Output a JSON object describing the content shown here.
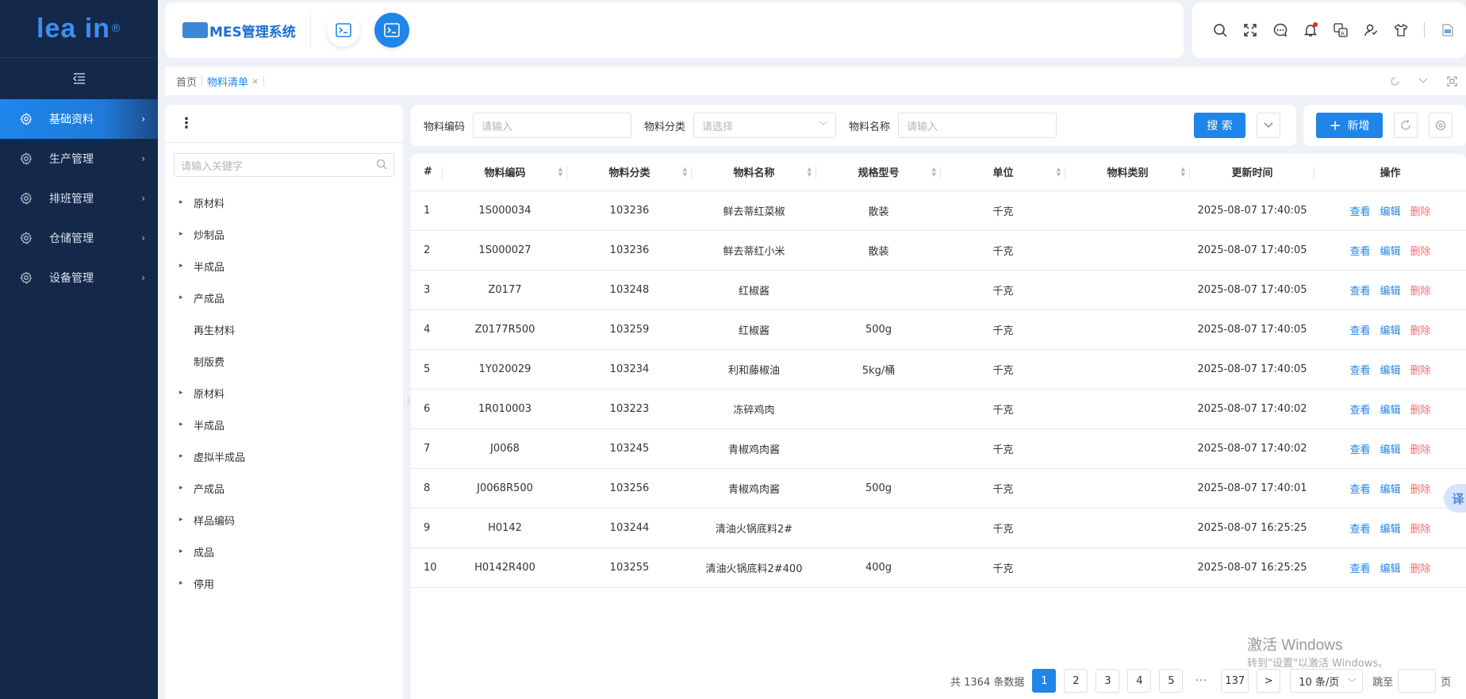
{
  "app": {
    "logo_text": "lea  in",
    "logo_mark": "®",
    "brand_text": "MES管理系统"
  },
  "sidebar": {
    "collapse_icon": "menu-fold-icon",
    "items": [
      {
        "label": "基础资料",
        "icon": "gear-icon",
        "active": true
      },
      {
        "label": "生产管理",
        "icon": "gear-icon",
        "active": false
      },
      {
        "label": "排班管理",
        "icon": "gear-icon",
        "active": false
      },
      {
        "label": "仓储管理",
        "icon": "gear-icon",
        "active": false
      },
      {
        "label": "设备管理",
        "icon": "gear-icon",
        "active": false
      }
    ]
  },
  "header": {
    "icons": [
      "search-icon",
      "fullscreen-icon",
      "message-icon",
      "bell-icon",
      "translate-icon",
      "user-icon",
      "theme-shirt-icon",
      "avatar-image"
    ]
  },
  "tabs": [
    {
      "label": "首页",
      "active": false
    },
    {
      "label": "物料清单",
      "active": true,
      "close": "×"
    }
  ],
  "tree": {
    "search_placeholder": "请输入关键字",
    "nodes": [
      {
        "label": "原材料",
        "expandable": true
      },
      {
        "label": "炒制品",
        "expandable": true
      },
      {
        "label": "半成品",
        "expandable": true
      },
      {
        "label": "产成品",
        "expandable": true
      },
      {
        "label": "再生材料",
        "expandable": false
      },
      {
        "label": "制版费",
        "expandable": false
      },
      {
        "label": "原材料",
        "expandable": true
      },
      {
        "label": "半成品",
        "expandable": true
      },
      {
        "label": "虚拟半成品",
        "expandable": true
      },
      {
        "label": "产成品",
        "expandable": true
      },
      {
        "label": "样品编码",
        "expandable": true
      },
      {
        "label": "成品",
        "expandable": true
      },
      {
        "label": "停用",
        "expandable": true
      }
    ]
  },
  "search": {
    "code_label": "物料编码",
    "code_placeholder": "请输入",
    "category_label": "物料分类",
    "category_placeholder": "请选择",
    "name_label": "物料名称",
    "name_placeholder": "请输入",
    "search_button": "搜 索",
    "add_button": "新增"
  },
  "table": {
    "columns": [
      "#",
      "物料编码",
      "物料分类",
      "物料名称",
      "规格型号",
      "单位",
      "物料类别",
      "更新时间",
      "操作"
    ],
    "actions": {
      "view": "查看",
      "edit": "编辑",
      "delete": "删除"
    },
    "rows": [
      {
        "idx": "1",
        "code": "1S000034",
        "cat": "103236",
        "name": "鲜去蒂红菜椒",
        "spec": "散装",
        "unit": "千克",
        "type": "",
        "time": "2025-08-07 17:40:05"
      },
      {
        "idx": "2",
        "code": "1S000027",
        "cat": "103236",
        "name": "鲜去蒂红小米",
        "spec": "散装",
        "unit": "千克",
        "type": "",
        "time": "2025-08-07 17:40:05"
      },
      {
        "idx": "3",
        "code": "Z0177",
        "cat": "103248",
        "name": "红椒酱",
        "spec": "",
        "unit": "千克",
        "type": "",
        "time": "2025-08-07 17:40:05"
      },
      {
        "idx": "4",
        "code": "Z0177R500",
        "cat": "103259",
        "name": "红椒酱",
        "spec": "500g",
        "unit": "千克",
        "type": "",
        "time": "2025-08-07 17:40:05"
      },
      {
        "idx": "5",
        "code": "1Y020029",
        "cat": "103234",
        "name": "利和藤椒油",
        "spec": "5kg/桶",
        "unit": "千克",
        "type": "",
        "time": "2025-08-07 17:40:05"
      },
      {
        "idx": "6",
        "code": "1R010003",
        "cat": "103223",
        "name": "冻碎鸡肉",
        "spec": "",
        "unit": "千克",
        "type": "",
        "time": "2025-08-07 17:40:02"
      },
      {
        "idx": "7",
        "code": "J0068",
        "cat": "103245",
        "name": "青椒鸡肉酱",
        "spec": "",
        "unit": "千克",
        "type": "",
        "time": "2025-08-07 17:40:02"
      },
      {
        "idx": "8",
        "code": "J0068R500",
        "cat": "103256",
        "name": "青椒鸡肉酱",
        "spec": "500g",
        "unit": "千克",
        "type": "",
        "time": "2025-08-07 17:40:01"
      },
      {
        "idx": "9",
        "code": "H0142",
        "cat": "103244",
        "name": "清油火锅底料2#",
        "spec": "",
        "unit": "千克",
        "type": "",
        "time": "2025-08-07 16:25:25"
      },
      {
        "idx": "10",
        "code": "H0142R400",
        "cat": "103255",
        "name": "清油火锅底料2#400",
        "spec": "400g",
        "unit": "千克",
        "type": "",
        "time": "2025-08-07 16:25:25"
      }
    ]
  },
  "pagination": {
    "total_text": "共 1364 条数据",
    "pages": [
      "1",
      "2",
      "3",
      "4",
      "5"
    ],
    "ellipsis": "···",
    "last_page": "137",
    "next": ">",
    "page_size": "10 条/页",
    "jump_label": "跳至",
    "jump_suffix": "页"
  },
  "overlay": {
    "watermark_title": "激活 Windows",
    "watermark_sub": "转到\"设置\"以激活 Windows。",
    "translate_button": "译"
  },
  "colors": {
    "accent": "#1f85e8",
    "sidebar_bg": "#14294a",
    "delete": "#f56c6c"
  }
}
